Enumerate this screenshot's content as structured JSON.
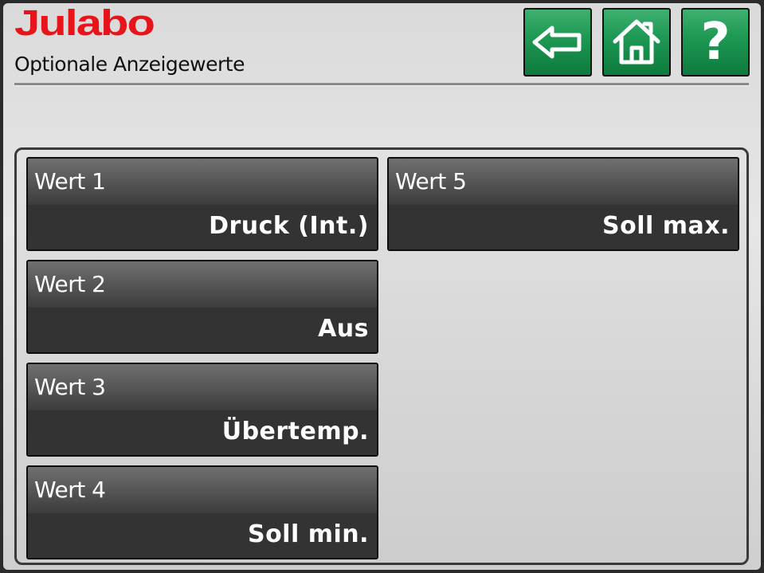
{
  "header": {
    "brand": "Julabo",
    "title": "Optionale Anzeigewerte"
  },
  "nav": {
    "back_icon": "back-arrow-icon",
    "home_icon": "home-icon",
    "help_label": "?",
    "accent": "#1f9a55"
  },
  "tiles": [
    {
      "label": "Wert 1",
      "value": "Druck (Int.)"
    },
    {
      "label": "Wert 2",
      "value": "Aus"
    },
    {
      "label": "Wert 3",
      "value": "Übertemp."
    },
    {
      "label": "Wert 4",
      "value": "Soll min."
    },
    {
      "label": "Wert 5",
      "value": "Soll max."
    }
  ]
}
